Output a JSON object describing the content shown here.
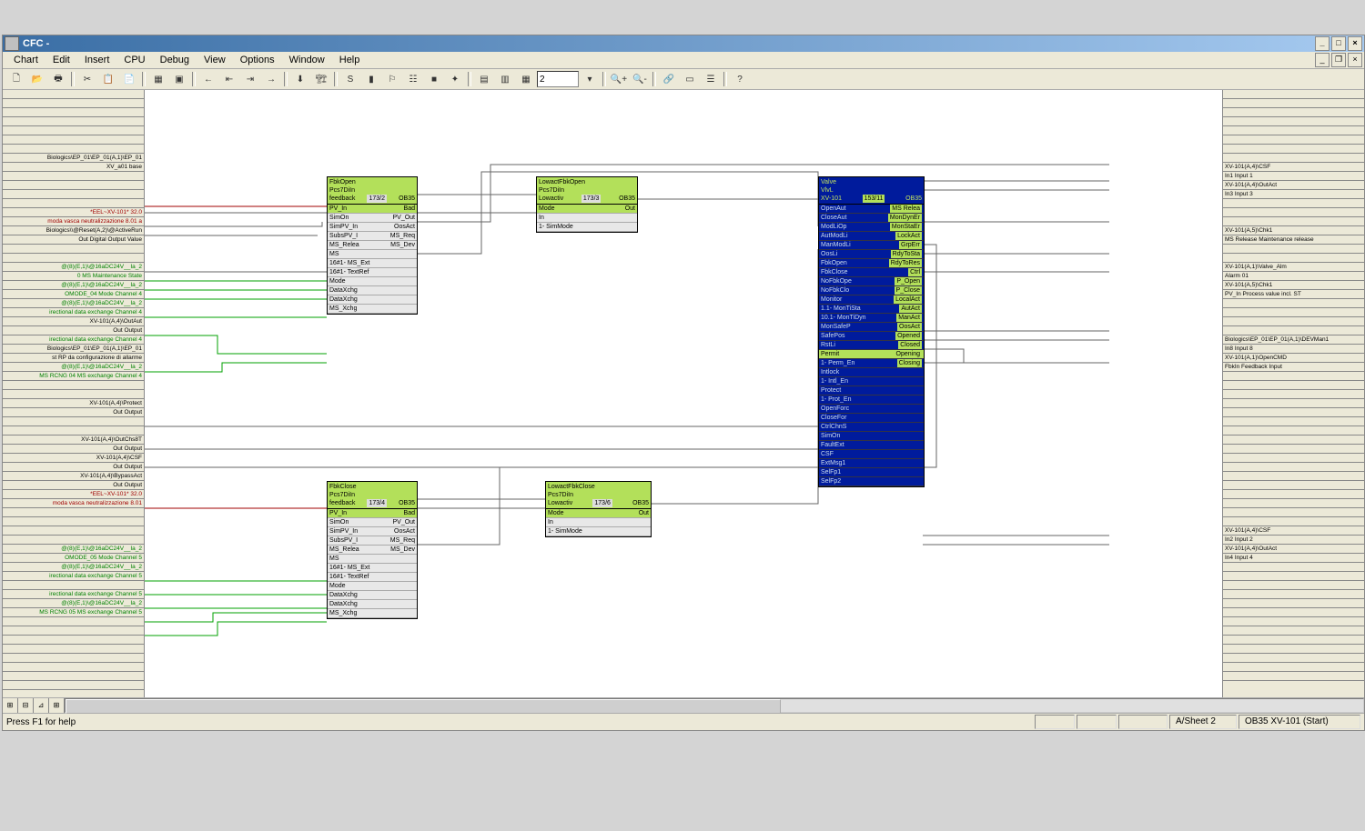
{
  "title_bar": {
    "title": "CFC -"
  },
  "menu": [
    "Chart",
    "Edit",
    "Insert",
    "CPU",
    "Debug",
    "View",
    "Options",
    "Window",
    "Help"
  ],
  "toolbar": {
    "zoom": "2"
  },
  "left_margin": [
    {
      "t": ""
    },
    {
      "t": ""
    },
    {
      "t": ""
    },
    {
      "t": ""
    },
    {
      "t": ""
    },
    {
      "t": ""
    },
    {
      "t": ""
    },
    {
      "t": "Biologics\\EP_01\\EP_01(A,1)\\EP_01"
    },
    {
      "t": "XV_a01 base"
    },
    {
      "t": ""
    },
    {
      "t": ""
    },
    {
      "t": ""
    },
    {
      "t": ""
    },
    {
      "t": "*EEL~XV-101* 32.0",
      "c": "red"
    },
    {
      "t": "moda vasca neutralizzazione 8.01 a",
      "c": "red"
    },
    {
      "t": "Biologics\\\\@Reset(A,2)\\@ActiveRun"
    },
    {
      "t": "Out Digital Output Value"
    },
    {
      "t": ""
    },
    {
      "t": ""
    },
    {
      "t": "@(8)(E,1)\\@16aDC24V__Ia_2",
      "c": "green"
    },
    {
      "t": "0 MS Maintenance State",
      "c": "green"
    },
    {
      "t": "@(8)(E,1)\\@16aDC24V__Ia_2",
      "c": "green"
    },
    {
      "t": "OMODE_04 Mode Channel 4",
      "c": "green"
    },
    {
      "t": "@(8)(E,1)\\@16aDC24V__Ia_2",
      "c": "green"
    },
    {
      "t": "irectional data exchange Channel 4",
      "c": "green"
    },
    {
      "t": "XV-101(A,4)\\OutAut"
    },
    {
      "t": "Out Output"
    },
    {
      "t": "irectional data exchange Channel 4",
      "c": "green"
    },
    {
      "t": "Biologics\\EP_01\\EP_01(A,1)\\EP_01"
    },
    {
      "t": "st RP da configurazione di allarme"
    },
    {
      "t": "@(8)(E,1)\\@16aDC24V__Ia_2",
      "c": "green"
    },
    {
      "t": "MS RCNG 04 MS exchange Channel 4",
      "c": "green"
    },
    {
      "t": ""
    },
    {
      "t": ""
    },
    {
      "t": "XV-101(A,4)\\Protect"
    },
    {
      "t": "Out Output"
    },
    {
      "t": ""
    },
    {
      "t": ""
    },
    {
      "t": "XV-101(A,4)\\OutChs8T"
    },
    {
      "t": "Out Output"
    },
    {
      "t": "XV-101(A,4)\\CSF"
    },
    {
      "t": "Out Output"
    },
    {
      "t": "XV-101(A,4)\\BypassAct"
    },
    {
      "t": "Out Output"
    },
    {
      "t": "*EEL~XV-101* 32.0",
      "c": "red"
    },
    {
      "t": "moda vasca neutralizzazione 8.01 ",
      "c": "red"
    },
    {
      "t": ""
    },
    {
      "t": ""
    },
    {
      "t": ""
    },
    {
      "t": ""
    },
    {
      "t": "@(8)(E,1)\\@16aDC24V__Ia_2",
      "c": "green"
    },
    {
      "t": "OMODE_05 Mode Channel 5",
      "c": "green"
    },
    {
      "t": "@(8)(E,1)\\@16aDC24V__Ia_2",
      "c": "green"
    },
    {
      "t": "irectional data exchange Channel 5",
      "c": "green"
    },
    {
      "t": ""
    },
    {
      "t": "irectional data exchange Channel 5",
      "c": "green"
    },
    {
      "t": "@(8)(E,1)\\@16aDC24V__Ia_2",
      "c": "green"
    },
    {
      "t": "MS RCNG 05 MS exchange Channel 5",
      "c": "green"
    },
    {
      "t": ""
    },
    {
      "t": ""
    },
    {
      "t": ""
    },
    {
      "t": ""
    },
    {
      "t": ""
    },
    {
      "t": ""
    },
    {
      "t": ""
    },
    {
      "t": ""
    }
  ],
  "right_margin": [
    {
      "t": ""
    },
    {
      "t": ""
    },
    {
      "t": ""
    },
    {
      "t": ""
    },
    {
      "t": ""
    },
    {
      "t": ""
    },
    {
      "t": ""
    },
    {
      "t": ""
    },
    {
      "t": "XV-101(A,4)\\CSF"
    },
    {
      "t": "In1 Input 1"
    },
    {
      "t": "XV-101(A,4)\\OutAct"
    },
    {
      "t": "In3 Input 3"
    },
    {
      "t": ""
    },
    {
      "t": ""
    },
    {
      "t": ""
    },
    {
      "t": "XV-101(A,5)\\Chk1"
    },
    {
      "t": "MS Release Maintenance release"
    },
    {
      "t": ""
    },
    {
      "t": ""
    },
    {
      "t": "XV-101(A,1)\\Valve_Alm"
    },
    {
      "t": "Alarm 01"
    },
    {
      "t": "XV-101(A,5)\\Chk1"
    },
    {
      "t": "PV_In Process value incl. ST"
    },
    {
      "t": ""
    },
    {
      "t": ""
    },
    {
      "t": ""
    },
    {
      "t": ""
    },
    {
      "t": "Biologics\\EP_01\\EP_01(A,1)\\DEVMan1"
    },
    {
      "t": "In8 Input 8"
    },
    {
      "t": "XV-101(A,1)\\OpenCMD"
    },
    {
      "t": "FbkIn Feedback Input"
    },
    {
      "t": ""
    },
    {
      "t": ""
    },
    {
      "t": ""
    },
    {
      "t": ""
    },
    {
      "t": ""
    },
    {
      "t": ""
    },
    {
      "t": ""
    },
    {
      "t": ""
    },
    {
      "t": ""
    },
    {
      "t": ""
    },
    {
      "t": ""
    },
    {
      "t": ""
    },
    {
      "t": ""
    },
    {
      "t": ""
    },
    {
      "t": ""
    },
    {
      "t": ""
    },
    {
      "t": ""
    },
    {
      "t": "XV-101(A,4)\\CSF"
    },
    {
      "t": "In2 Input 2"
    },
    {
      "t": "XV-101(A,4)\\OutAct"
    },
    {
      "t": "In4 Input 4"
    },
    {
      "t": ""
    },
    {
      "t": ""
    },
    {
      "t": ""
    },
    {
      "t": ""
    },
    {
      "t": ""
    },
    {
      "t": ""
    },
    {
      "t": ""
    },
    {
      "t": ""
    },
    {
      "t": ""
    },
    {
      "t": ""
    },
    {
      "t": ""
    },
    {
      "t": ""
    },
    {
      "t": ""
    }
  ],
  "blocks": {
    "fbkopen": {
      "title": "FbkOpen",
      "sub1": "Pcs7DiIn",
      "sub2": "feedback",
      "tag": "173/2",
      "ob": "OB35",
      "rows": [
        {
          "l": "PV_In",
          "r": "Bad",
          "hl": true
        },
        {
          "l": "SimOn",
          "r": "PV_Out"
        },
        {
          "l": "SimPV_In",
          "r": "OosAct"
        },
        {
          "l": "SubsPV_I",
          "r": "MS_Req"
        },
        {
          "l": "MS_Relea",
          "r": "MS_Dev"
        },
        {
          "l": "MS",
          "r": ""
        },
        {
          "l": "MS_Ext",
          "r": "",
          "n": "16#1"
        },
        {
          "l": "TextRef",
          "r": "",
          "n": "16#1"
        },
        {
          "l": "Mode",
          "r": ""
        },
        {
          "l": "DataXchg",
          "r": ""
        },
        {
          "l": "DataXchg",
          "r": ""
        },
        {
          "l": "MS_Xchg",
          "r": ""
        }
      ]
    },
    "lowactopen": {
      "title": "LowactFbkOpen",
      "sub1": "Pcs7DiIn",
      "sub2": "Lowactiv",
      "tag": "173/3",
      "ob": "OB35",
      "rows": [
        {
          "l": "Mode",
          "r": "Out",
          "hl": true
        },
        {
          "l": "In",
          "r": ""
        },
        {
          "l": "SimMode",
          "r": "",
          "n": "1"
        }
      ]
    },
    "fbkclose": {
      "title": "FbkClose",
      "sub1": "Pcs7DiIn",
      "sub2": "feedback",
      "tag": "173/4",
      "ob": "OB35",
      "rows": [
        {
          "l": "PV_In",
          "r": "Bad",
          "hl": true
        },
        {
          "l": "SimOn",
          "r": "PV_Out"
        },
        {
          "l": "SimPV_In",
          "r": "OosAct"
        },
        {
          "l": "SubsPV_I",
          "r": "MS_Req"
        },
        {
          "l": "MS_Relea",
          "r": "MS_Dev"
        },
        {
          "l": "MS",
          "r": ""
        },
        {
          "l": "MS_Ext",
          "r": "",
          "n": "16#1"
        },
        {
          "l": "TextRef",
          "r": "",
          "n": "16#1"
        },
        {
          "l": "Mode",
          "r": ""
        },
        {
          "l": "DataXchg",
          "r": ""
        },
        {
          "l": "DataXchg",
          "r": ""
        },
        {
          "l": "MS_Xchg",
          "r": ""
        }
      ]
    },
    "lowactclose": {
      "title": "LowactFbkClose",
      "sub1": "Pcs7DiIn",
      "sub2": "Lowactiv",
      "tag": "173/6",
      "ob": "OB35",
      "rows": [
        {
          "l": "Mode",
          "r": "Out",
          "hl": true
        },
        {
          "l": "In",
          "r": ""
        },
        {
          "l": "SimMode",
          "r": "",
          "n": "1"
        }
      ]
    },
    "valve": {
      "title": "Valve",
      "sub1": "VlvL",
      "sub2": "XV-101",
      "tag": "153/11",
      "ob": "OB35",
      "rows": [
        {
          "l": "OpenAut",
          "r": "MS Relea"
        },
        {
          "l": "CloseAut",
          "r": "MonDynEr"
        },
        {
          "l": "ModLiOp",
          "r": "MonStaEr"
        },
        {
          "l": "AutModLi",
          "r": "LockAct"
        },
        {
          "l": "ManModLi",
          "r": "GrpErr"
        },
        {
          "l": "OosLi",
          "r": "RdyToSta"
        },
        {
          "l": "FbkOpen",
          "r": "RdyToRes"
        },
        {
          "l": "FbkClose",
          "r": "Ctrl"
        },
        {
          "l": "NoFbkOpe",
          "r": "P_Open"
        },
        {
          "l": "NoFbkClo",
          "r": "P_Close"
        },
        {
          "l": "Monitor",
          "r": "LocalAct"
        },
        {
          "l": "MonTiSta",
          "r": "AutAct",
          "n": "1.1"
        },
        {
          "l": "MonTiDyn",
          "r": "ManAct",
          "n": "10.1"
        },
        {
          "l": "MonSafeP",
          "r": "OosAct"
        },
        {
          "l": "SafePos",
          "r": "Opened"
        },
        {
          "l": "RstLi",
          "r": "Closed"
        },
        {
          "l": "Permit",
          "r": "Opening",
          "g": true
        },
        {
          "l": "Perm_En",
          "r": "Closing",
          "n": "1"
        },
        {
          "l": "Intlock",
          "r": ""
        },
        {
          "l": "Intl_En",
          "r": "",
          "n": "1"
        },
        {
          "l": "Protect",
          "r": ""
        },
        {
          "l": "Prot_En",
          "r": "",
          "n": "1"
        },
        {
          "l": "OpenForc",
          "r": ""
        },
        {
          "l": "CloseFor",
          "r": ""
        },
        {
          "l": "CtrlChnS",
          "r": ""
        },
        {
          "l": "SimOn",
          "r": ""
        },
        {
          "l": "FaultExt",
          "r": ""
        },
        {
          "l": "CSF",
          "r": ""
        },
        {
          "l": "ExtMsg1",
          "r": ""
        },
        {
          "l": "SelFp1",
          "r": ""
        },
        {
          "l": "SelFp2",
          "r": ""
        }
      ]
    }
  },
  "tabs": [
    "⊞",
    "⊟",
    "⊿",
    "⊞"
  ],
  "status": {
    "help": "Press F1 for help",
    "sheet": "A/Sheet 2",
    "ob": "OB35 XV-101 (Start)"
  }
}
